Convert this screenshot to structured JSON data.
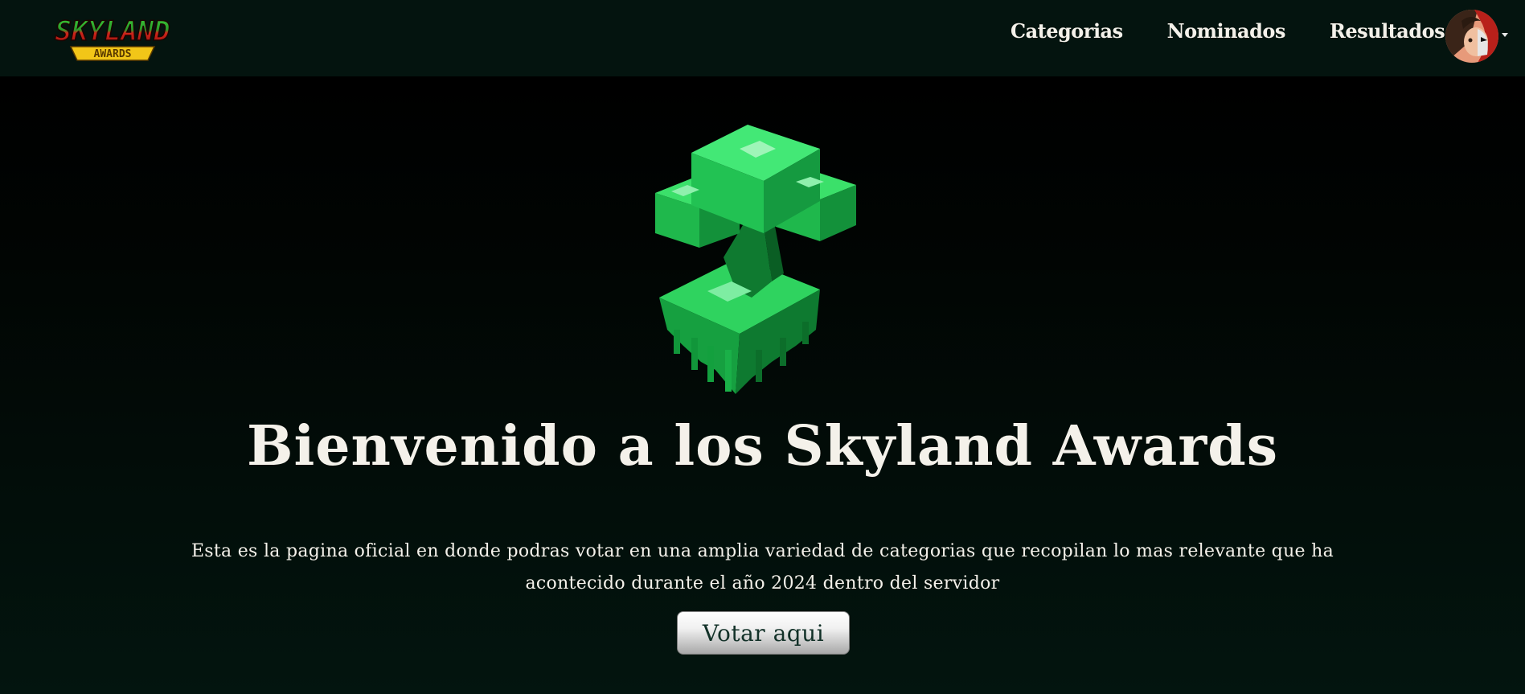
{
  "brand": {
    "logo_top": "SKYLAND",
    "logo_bottom": "AWARDS",
    "logo_colors": {
      "red": "#d0241a",
      "green": "#3fbf3a",
      "gold": "#f2c618"
    }
  },
  "nav": {
    "links": [
      {
        "label": "Categorias"
      },
      {
        "label": "Nominados"
      },
      {
        "label": "Resultados"
      }
    ],
    "user_icon": "user-avatar-icon",
    "dropdown_icon": "caret-down-icon"
  },
  "hero": {
    "image_icon": "emerald-tree-trophy-icon",
    "title": "Bienvenido a los Skyland Awards",
    "description": "Esta es la pagina oficial en donde podras votar en una amplia variedad de categorias que recopilan lo mas relevante que ha acontecido durante el año 2024 dentro del servidor",
    "cta_label": "Votar aqui"
  },
  "colors": {
    "navbar_bg": "#04140f",
    "page_bg": "#000000",
    "text": "#f4f1ea",
    "emerald": "#1fbf5a",
    "button_text": "#123128"
  }
}
